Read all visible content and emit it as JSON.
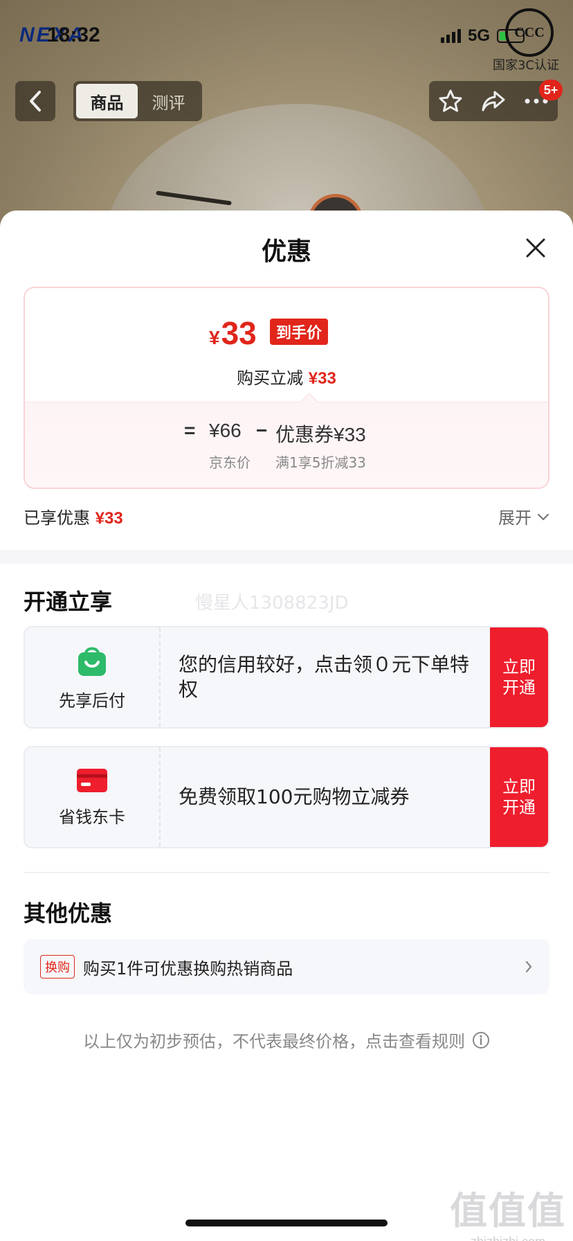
{
  "status_bar": {
    "time": "18:32",
    "network": "5G",
    "brand": "NEXA"
  },
  "cert": {
    "logo_text": "CCC",
    "label": "国家3C认证"
  },
  "nav": {
    "tabs": [
      {
        "label": "商品",
        "active": true
      },
      {
        "label": "测评",
        "active": false
      }
    ],
    "badge": "5+",
    "icons": [
      "back-icon",
      "star-icon",
      "share-icon",
      "more-icon"
    ]
  },
  "sheet": {
    "title": "优惠",
    "price": {
      "currency": "¥",
      "final": "33",
      "final_tag": "到手价",
      "reduce_label": "购买立减",
      "reduce_value": "¥33",
      "eq": "=",
      "jd_price": "¥66",
      "minus": "−",
      "coupon": "优惠券¥33",
      "jd_label": "京东价",
      "coupon_rule": "满1享5折减33"
    },
    "enjoyed": {
      "label": "已享优惠",
      "value": "¥33",
      "expand": "展开"
    },
    "open_section": {
      "title": "开通立享",
      "watermark": "慢星人1308823JD",
      "cards": [
        {
          "name": "先享后付",
          "text": "您的信用较好，点击领０元下单特权",
          "cta": "立即开通",
          "icon": "shopping-bag-icon"
        },
        {
          "name": "省钱东卡",
          "text": "免费领取100元购物立减券",
          "cta": "立即开通",
          "icon": "card-icon"
        }
      ]
    },
    "other_section": {
      "title": "其他优惠",
      "tag": "换购",
      "text": "购买1件可优惠换购热销商品"
    },
    "footnote": "以上仅为初步预估，不代表最终价格，点击查看规则",
    "site_mark": {
      "big": "值值值",
      "small": "zhizhizhi.com"
    }
  },
  "colors": {
    "accent": "#e1251b",
    "cta": "#ee1e2d",
    "green": "#2dbb6a"
  }
}
